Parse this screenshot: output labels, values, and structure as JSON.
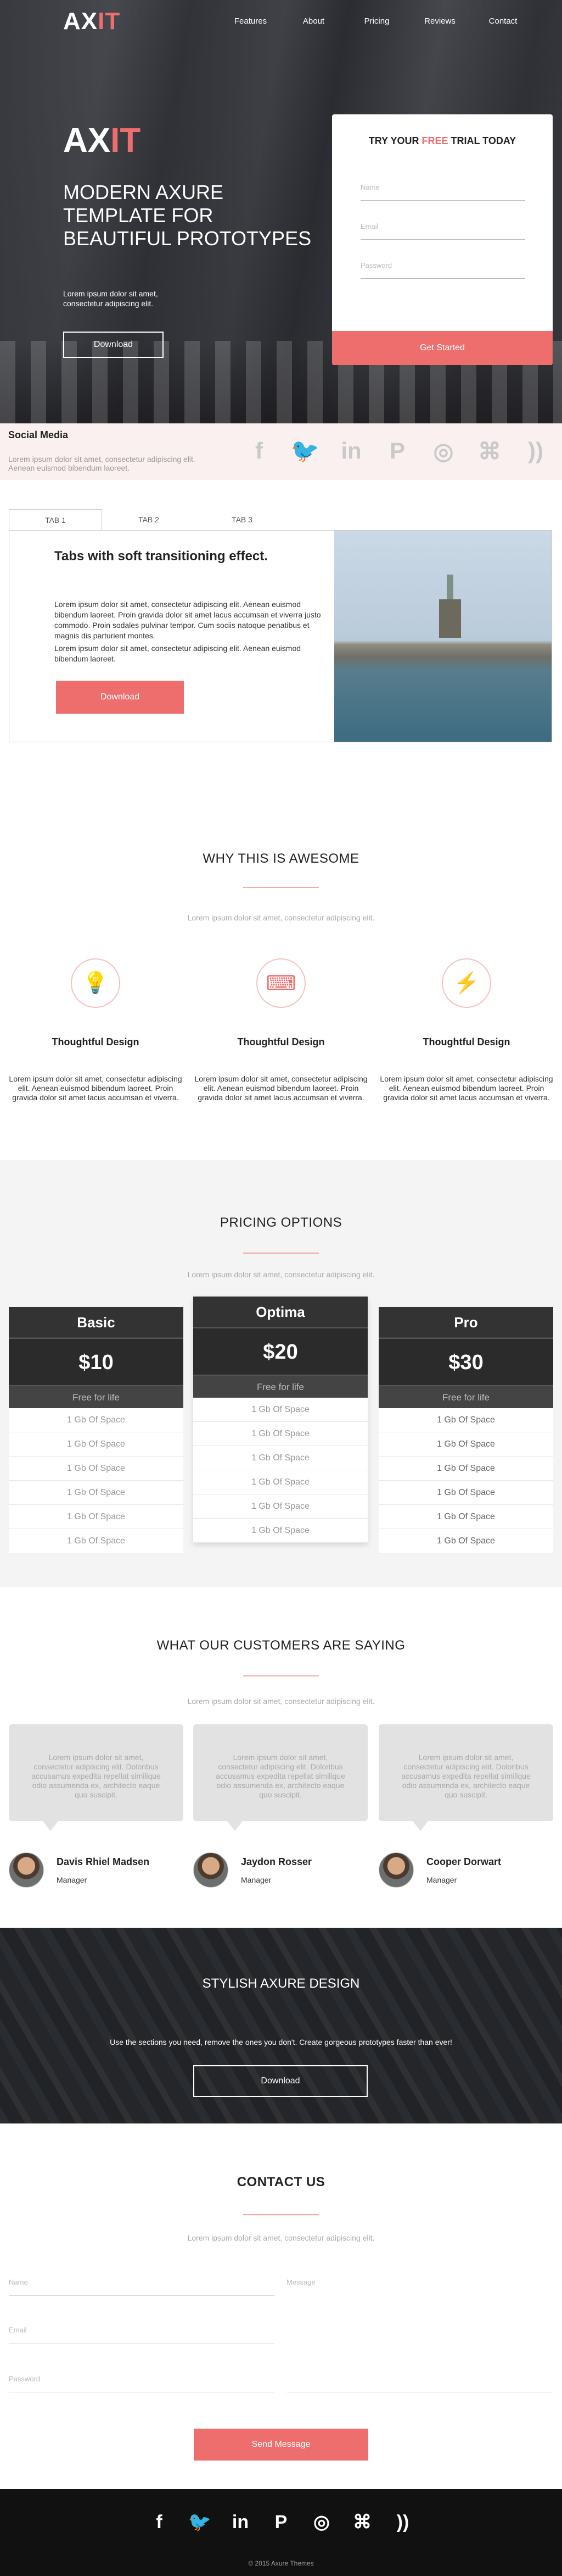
{
  "brand": {
    "logo_white": "AX",
    "logo_red": "IT"
  },
  "nav": {
    "items": [
      "Features",
      "About",
      "Pricing",
      "Reviews",
      "Contact"
    ]
  },
  "hero": {
    "title_line1": "MODERN AXURE",
    "title_line2": "TEMPLATE FOR",
    "title_line3": "BEAUTIFUL PROTOTYPES",
    "text": "Lorem ipsum dolor sit amet, consectetur adipiscing elit.",
    "download_label": "Download"
  },
  "trial": {
    "title_before": "TRY YOUR ",
    "title_highlight": "FREE",
    "title_after": " TRIAL TODAY",
    "name_placeholder": "Name",
    "email_placeholder": "Email",
    "password_placeholder": "Password",
    "submit_label": "Get Started"
  },
  "social": {
    "title": "Social Media",
    "text": "Lorem ipsum dolor sit amet, consectetur adipiscing elit. Aenean euismod bibendum laoreet.",
    "icons": [
      "facebook-icon",
      "twitter-icon",
      "linkedin-icon",
      "pinterest-icon",
      "instagram-icon",
      "github-icon",
      "rss-icon"
    ]
  },
  "tabs": {
    "labels": [
      "TAB 1",
      "TAB 2",
      "TAB 3"
    ],
    "heading": "Tabs with soft transitioning effect.",
    "para1": "Lorem ipsum dolor sit amet, consectetur adipiscing elit. Aenean euismod bibendum laoreet. Proin gravida dolor sit amet lacus accumsan et viverra justo commodo. Proin sodales pulvinar tempor. Cum sociis natoque penatibus et magnis dis parturient montes.",
    "para2": "Lorem ipsum dolor sit amet, consectetur adipiscing elit. Aenean euismod bibendum laoreet.",
    "download_label": "Download"
  },
  "why": {
    "title": "WHY THIS IS AWESOME",
    "subtitle": "Lorem ipsum dolor sit amet, consectetur adipiscing elit.",
    "features": [
      {
        "icon": "lightbulb-icon",
        "title": "Thoughtful Design",
        "text": "Lorem ipsum dolor sit amet, consectetur adipiscing elit. Aenean euismod bibendum laoreet. Proin gravida  dolor sit amet lacus accumsan et viverra."
      },
      {
        "icon": "keyboard-icon",
        "title": "Thoughtful Design",
        "text": "Lorem ipsum dolor sit amet, consectetur adipiscing elit. Aenean euismod bibendum laoreet. Proin gravida  dolor sit amet lacus accumsan et viverra."
      },
      {
        "icon": "lightning-icon",
        "title": "Thoughtful Design",
        "text": "Lorem ipsum dolor sit amet, consectetur adipiscing elit. Aenean euismod bibendum laoreet. Proin gravida  dolor sit amet lacus accumsan et viverra."
      }
    ]
  },
  "pricing": {
    "title": "PRICING OPTIONS",
    "subtitle": "Lorem ipsum dolor sit amet, consectetur adipiscing elit.",
    "plans": [
      {
        "name": "Basic",
        "price": "$10",
        "tagline": "Free for life",
        "features": [
          "1 Gb Of Space",
          "1 Gb Of Space",
          "1 Gb Of Space",
          "1 Gb Of Space",
          "1 Gb Of Space",
          "1 Gb Of Space"
        ]
      },
      {
        "name": "Optima",
        "price": "$20",
        "tagline": "Free for life",
        "features": [
          "1 Gb Of Space",
          "1 Gb Of Space",
          "1 Gb Of Space",
          "1 Gb Of Space",
          "1 Gb Of Space",
          "1 Gb Of Space"
        ]
      },
      {
        "name": "Pro",
        "price": "$30",
        "tagline": "Free for life",
        "features": [
          "1 Gb Of Space",
          "1 Gb Of Space",
          "1 Gb Of Space",
          "1 Gb Of Space",
          "1 Gb Of Space",
          "1 Gb Of Space"
        ]
      }
    ]
  },
  "testimonials": {
    "title": "WHAT OUR CUSTOMERS ARE SAYING",
    "subtitle": "Lorem ipsum dolor sit amet, consectetur adipiscing elit.",
    "items": [
      {
        "quote": "Lorem ipsum dolor sit amet, consectetur adipiscing elit. Doloribus accusamus expedita repellat similique odio assumenda ex, architecto eaque quo suscipit.",
        "name": "Davis Rhiel Madsen",
        "role": "Manager"
      },
      {
        "quote": "Lorem ipsum dolor sit amet, consectetur adipiscing elit. Doloribus accusamus expedita repellat similique odio assumenda ex, architecto eaque quo suscipit.",
        "name": "Jaydon Rosser",
        "role": "Manager"
      },
      {
        "quote": "Lorem ipsum dolor sit amet, consectetur adipiscing elit. Doloribus accusamus expedita repellat similique odio assumenda ex, architecto eaque quo suscipit.",
        "name": "Cooper Dorwart",
        "role": "Manager"
      }
    ]
  },
  "cta": {
    "title": "STYLISH AXURE DESIGN",
    "text": "Use the sections you need, remove the ones you don't. Create gorgeous prototypes faster than ever!",
    "download_label": "Download"
  },
  "contact": {
    "title": "CONTACT US",
    "subtitle": "Lorem ipsum dolor sit amet, consectetur adipiscing elit.",
    "name_placeholder": "Name",
    "email_placeholder": "Email",
    "password_placeholder": "Password",
    "message_placeholder": "Message",
    "send_label": "Send Message"
  },
  "footer": {
    "icons": [
      "facebook-icon",
      "twitter-icon",
      "linkedin-icon",
      "pinterest-icon",
      "instagram-icon",
      "github-icon",
      "rss-icon"
    ],
    "copyright": "© 2015 Axure Themes"
  },
  "colors": {
    "accent": "#ee6e6e",
    "dark": "#333333",
    "footer": "#111111"
  }
}
